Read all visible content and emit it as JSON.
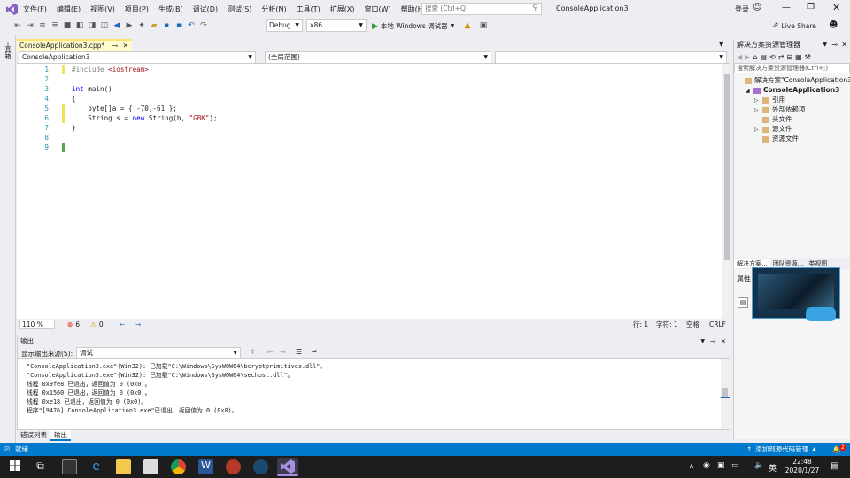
{
  "menu": [
    "文件(F)",
    "编辑(E)",
    "视图(V)",
    "项目(P)",
    "生成(B)",
    "调试(D)",
    "测试(S)",
    "分析(N)",
    "工具(T)",
    "扩展(X)",
    "窗口(W)",
    "帮助(H)"
  ],
  "search_placeholder": "搜索 (Ctrl+Q)",
  "solution_title": "ConsoleApplication3",
  "login": "登录",
  "live_share": "Live Share",
  "config_combo": "Debug",
  "platform_combo": "x86",
  "run_button": "本地 Windows 调试器",
  "left_strip_label": "工具箱",
  "doc_tab": "ConsoleApplication3.cpp*",
  "nav": {
    "project": "ConsoleApplication3",
    "scope": "(全局范围)"
  },
  "code_lines": [
    {
      "n": "1",
      "text": "#include <iostream>"
    },
    {
      "n": "2",
      "text": ""
    },
    {
      "n": "3",
      "text": "int main()"
    },
    {
      "n": "4",
      "text": "{"
    },
    {
      "n": "5",
      "text": "    byte[]a = { -70,-61 };"
    },
    {
      "n": "6",
      "text": "    String s = new String(b, \"GBK\");"
    },
    {
      "n": "7",
      "text": "}"
    },
    {
      "n": "8",
      "text": ""
    },
    {
      "n": "9",
      "text": ""
    }
  ],
  "editor_status": {
    "zoom": "110 %",
    "errors": "6",
    "warnings": "0",
    "line": "行: 1",
    "char": "字符: 1",
    "space": "空格",
    "eol": "CRLF"
  },
  "output": {
    "title": "输出",
    "source_label": "显示输出来源(S):",
    "source_value": "调试",
    "lines": [
      "\"ConsoleApplication3.exe\"(Win32): 已加载\"C:\\Windows\\SysWOW64\\bcryptprimitives.dll\"。",
      "\"ConsoleApplication3.exe\"(Win32): 已加载\"C:\\Windows\\SysWOW64\\sechost.dll\"。",
      "线程 0x9fe8 已退出，返回值为 0 (0x0)。",
      "线程 0x1560 已退出，返回值为 0 (0x0)。",
      "线程 0xe18 已退出，返回值为 0 (0x0)。",
      "程序\"[9476] ConsoleApplication3.exe\"已退出，返回值为 0 (0x0)。"
    ],
    "tabs": [
      "错误列表",
      "输出"
    ]
  },
  "solution_explorer": {
    "title": "解决方案资源管理器",
    "search_placeholder": "搜索解决方案资源管理器(Ctrl+;)",
    "items": [
      {
        "label": "解决方案\"ConsoleApplication3\"",
        "indent": 0,
        "bold": false,
        "arrow": ""
      },
      {
        "label": "ConsoleApplication3",
        "indent": 1,
        "bold": true,
        "arrow": "◢"
      },
      {
        "label": "引用",
        "indent": 2,
        "bold": false,
        "arrow": "▷"
      },
      {
        "label": "外部依赖项",
        "indent": 2,
        "bold": false,
        "arrow": "▷"
      },
      {
        "label": "头文件",
        "indent": 2,
        "bold": false,
        "arrow": ""
      },
      {
        "label": "源文件",
        "indent": 2,
        "bold": false,
        "arrow": "▷"
      },
      {
        "label": "资源文件",
        "indent": 2,
        "bold": false,
        "arrow": ""
      }
    ],
    "bottom_tabs": [
      "解决方案...",
      "团队资源...",
      "类视图"
    ],
    "properties_title": "属性"
  },
  "statusbar": {
    "ready": "就绪",
    "source_control": "添加到源代码管理",
    "notif_count": "2"
  },
  "taskbar": {
    "time": "22:48",
    "date": "2020/1/27",
    "ime": "英"
  },
  "colors": {
    "accent": "#007acc",
    "vs_purple": "#68217a"
  }
}
